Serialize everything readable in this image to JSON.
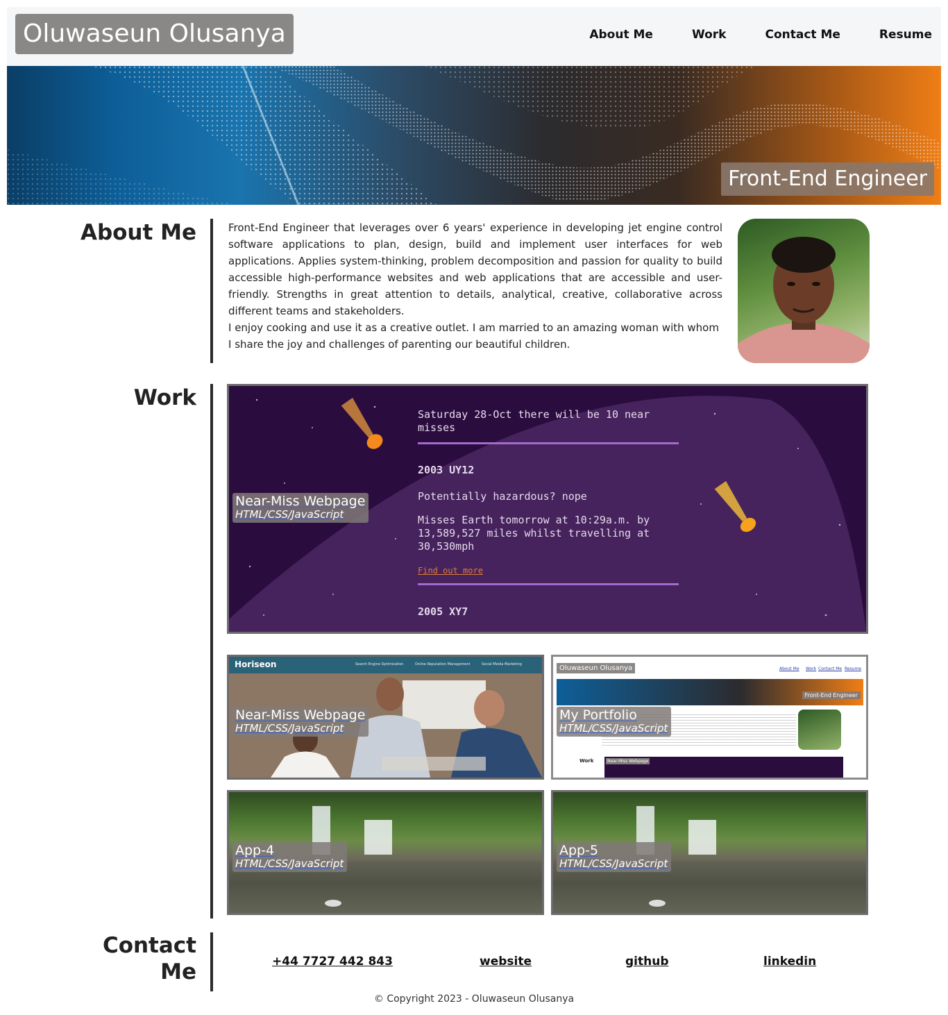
{
  "header": {
    "name": "Oluwaseun Olusanya",
    "nav": [
      "About Me",
      "Work",
      "Contact Me",
      "Resume"
    ]
  },
  "hero": {
    "badge": "Front-End Engineer"
  },
  "about": {
    "title": "About Me",
    "paragraph1": "Front-End Engineer that leverages over 6 years' experience in developing jet engine control software applications to plan, design, build and implement user interfaces for web applications. Applies system-thinking, problem decomposition and passion for quality to build accessible high-performance websites and web applications that are accessible and user-friendly. Strengths in great attention to details, analytical, creative, collaborative across different teams and stakeholders.",
    "paragraph2": "I enjoy cooking and use it as a creative outlet. I am married to an amazing woman with whom I share the joy and challenges of parenting our beautiful children."
  },
  "work": {
    "title": "Work",
    "featured": {
      "title": "Near-Miss Webpage",
      "tech": "HTML/CSS/JavaScript",
      "screenshot": {
        "headline": "Saturday 28-Oct there will be 10 near misses",
        "asteroid1": "2003 UY12",
        "hazard": "Potentially hazardous? nope",
        "detail": "Misses Earth tomorrow at 10:29a.m. by 13,589,527 miles whilst travelling at 30,530mph",
        "link": "Find out more",
        "asteroid2": "2005 XY7"
      }
    },
    "cards": [
      {
        "title": "Near-Miss Webpage",
        "tech": "HTML/CSS/JavaScript",
        "shot_brand": "Horiseon",
        "shot_nav": [
          "Search Engine Optimization",
          "Online Reputation Management",
          "Social Media Marketing"
        ]
      },
      {
        "title": "My Portfolio",
        "tech": "HTML/CSS/JavaScript",
        "shot_brand": "Oluwaseun Olusanya",
        "shot_nav": [
          "About Me",
          "Work",
          "Contact Me",
          "Resume"
        ],
        "shot_badge": "Front-End Engineer",
        "shot_work": "Work",
        "shot_card": "Near-Miss Webpage"
      },
      {
        "title": "App-4",
        "tech": "HTML/CSS/JavaScript"
      },
      {
        "title": "App-5",
        "tech": "HTML/CSS/JavaScript"
      }
    ]
  },
  "contact": {
    "title_line1": "Contact",
    "title_line2": "Me",
    "links": [
      "+44 7727 442 843",
      "website",
      "github",
      "linkedin"
    ]
  },
  "footer": {
    "copyright": "© Copyright 2023 - Oluwaseun Olusanya"
  },
  "colors": {
    "brand_bg": "#8a8886",
    "bar": "#2b2a2e",
    "space_bg": "#2b0c3e",
    "hero_left": "#0d5f99",
    "hero_right": "#ef7e16"
  }
}
